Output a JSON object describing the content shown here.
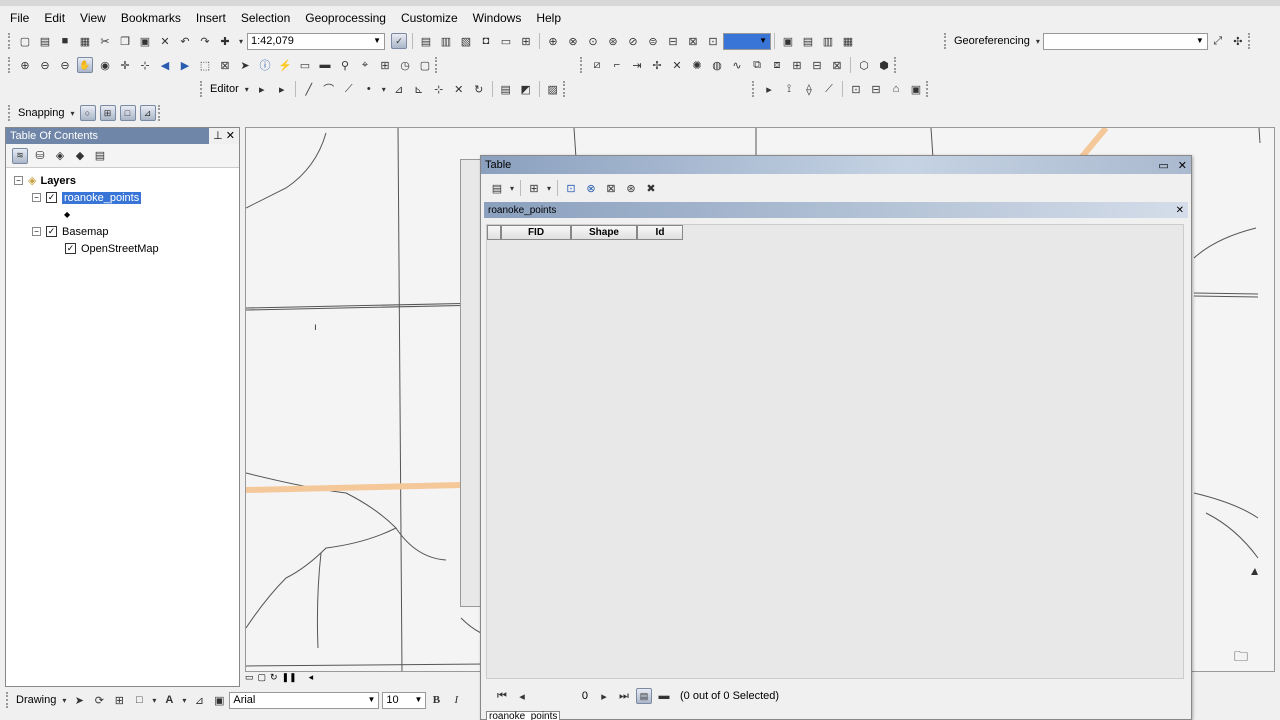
{
  "menu": [
    "File",
    "Edit",
    "View",
    "Bookmarks",
    "Insert",
    "Selection",
    "Geoprocessing",
    "Customize",
    "Windows",
    "Help"
  ],
  "standard_toolbar": {
    "scale": "1:42,079"
  },
  "georef_toolbar": {
    "label": "Georeferencing",
    "layer_value": ""
  },
  "editor_toolbar": {
    "label": "Editor"
  },
  "snapping_toolbar": {
    "label": "Snapping"
  },
  "toc": {
    "title": "Table Of Contents",
    "items": [
      {
        "label": "Layers"
      },
      {
        "label": "roanoke_points"
      },
      {
        "label": "Basemap"
      },
      {
        "label": "OpenStreetMap"
      }
    ]
  },
  "table_window": {
    "title": "Table",
    "tab_title": "roanoke_points",
    "columns": [
      "FID",
      "Shape",
      "Id"
    ],
    "record_position": "0",
    "selection_status": "(0 out of 0 Selected)",
    "bottom_tab": "roanoke_points"
  },
  "drawing_toolbar": {
    "label": "Drawing",
    "font": "Arial",
    "font_size": "10"
  },
  "colors": {
    "road": "#f5c89a",
    "toc_title": "#6f86a8",
    "selection": "#3875d7"
  }
}
